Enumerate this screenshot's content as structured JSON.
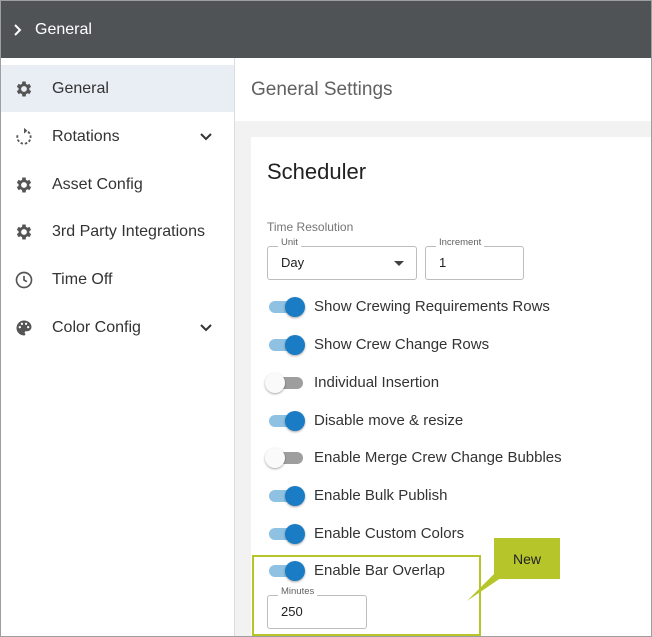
{
  "topbar": {
    "title": "General"
  },
  "sidebar": {
    "items": [
      {
        "label": "General",
        "icon": "gear-icon",
        "active": true
      },
      {
        "label": "Rotations",
        "icon": "rotate-icon",
        "expandable": true
      },
      {
        "label": "Asset Config",
        "icon": "gear-icon"
      },
      {
        "label": "3rd Party Integrations",
        "icon": "gear-icon"
      },
      {
        "label": "Time Off",
        "icon": "clock-icon"
      },
      {
        "label": "Color Config",
        "icon": "palette-icon",
        "expandable": true
      }
    ]
  },
  "main": {
    "page_title": "General Settings",
    "card": {
      "title": "Scheduler",
      "time_resolution": {
        "label": "Time Resolution",
        "unit_label": "Unit",
        "unit_value": "Day",
        "increment_label": "Increment",
        "increment_value": "1"
      },
      "toggles": [
        {
          "label": "Show Crewing Requirements Rows",
          "on": true
        },
        {
          "label": "Show Crew Change Rows",
          "on": true
        },
        {
          "label": "Individual Insertion",
          "on": false
        },
        {
          "label": "Disable move & resize",
          "on": true
        },
        {
          "label": "Enable Merge Crew Change Bubbles",
          "on": false
        },
        {
          "label": "Enable Bulk Publish",
          "on": true
        },
        {
          "label": "Enable Custom Colors",
          "on": true
        },
        {
          "label": "Enable Bar Overlap",
          "on": true
        }
      ],
      "minutes": {
        "label": "Minutes",
        "value": "250"
      }
    }
  },
  "callout": {
    "text": "New"
  },
  "colors": {
    "topbar_bg": "#4f5356",
    "switch_on": "#1a7cc4",
    "callout": "#b5c52a"
  }
}
